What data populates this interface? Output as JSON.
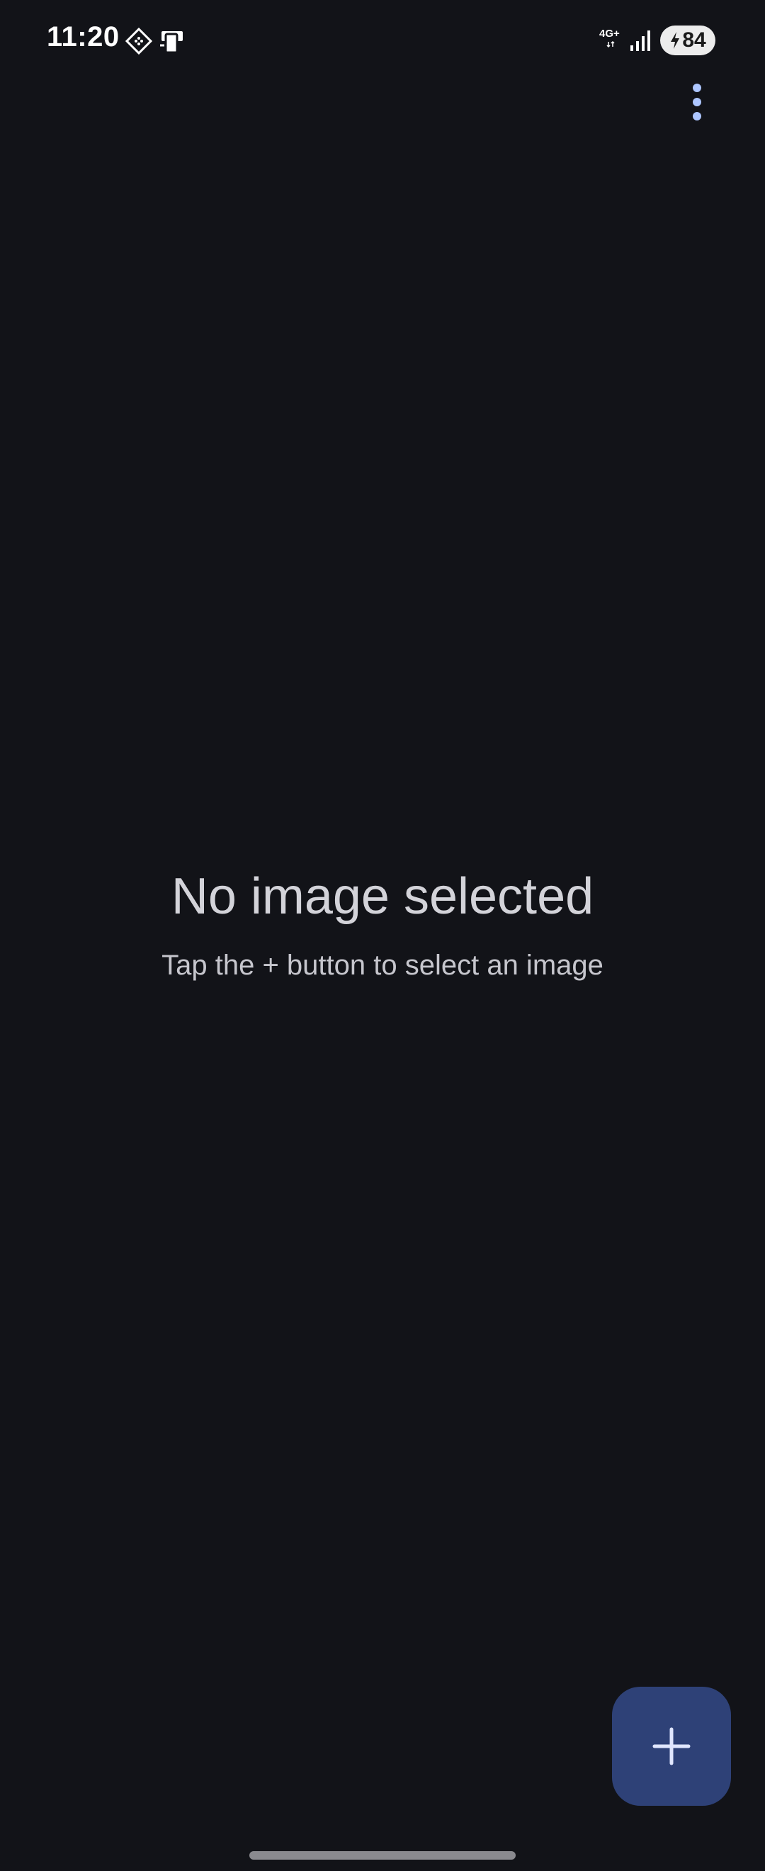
{
  "status_bar": {
    "time": "11:20",
    "network_label": "4G+",
    "battery_level": "84",
    "icons": [
      "notification-diamond-icon",
      "notification-device-icon",
      "network-4g-icon",
      "signal-strength-icon",
      "battery-charging-icon"
    ]
  },
  "app_bar": {
    "menu_icon": "more-vert-icon"
  },
  "empty_state": {
    "title": "No image selected",
    "subtitle": "Tap the + button to select an image"
  },
  "fab": {
    "icon": "add-icon"
  },
  "colors": {
    "background": "#121318",
    "accent": "#adc6ff",
    "fab_background": "#2e4177",
    "title_text": "#d3d3d9",
    "subtitle_text": "#c6c6cd"
  }
}
